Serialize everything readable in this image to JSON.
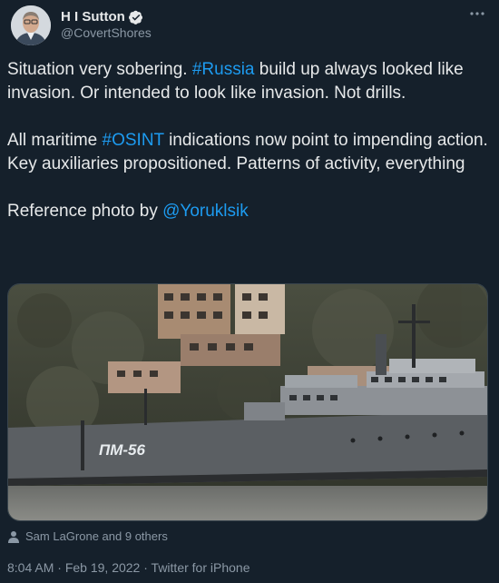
{
  "header": {
    "name": "H I Sutton",
    "handle": "@CovertShores",
    "verified_icon": "verified-badge-icon",
    "more_icon": "more-horizontal-icon"
  },
  "tweet": {
    "p1_a": "Situation very sobering. ",
    "p1_link": "#Russia",
    "p1_b": " build up always looked like invasion. Or intended to look like invasion. Not drills.",
    "p2_a": "All maritime ",
    "p2_link": "#OSINT",
    "p2_b": " indications now point to impending action. Key auxiliaries propositioned. Patterns of activity, everything",
    "p3_a": "Reference photo by ",
    "p3_link": "@Yoruklsik"
  },
  "photo": {
    "hull_label": "ПМ-56"
  },
  "tagged": {
    "text": "Sam LaGrone and 9 others",
    "icon": "person-icon"
  },
  "meta": {
    "time": "8:04 AM",
    "sep1": " · ",
    "date": "Feb 19, 2022",
    "sep2": " · ",
    "client": "Twitter for iPhone"
  },
  "colors": {
    "background": "#15202b",
    "text": "#e7e9ea",
    "secondary": "#8b98a5",
    "link": "#1d9bf0"
  }
}
